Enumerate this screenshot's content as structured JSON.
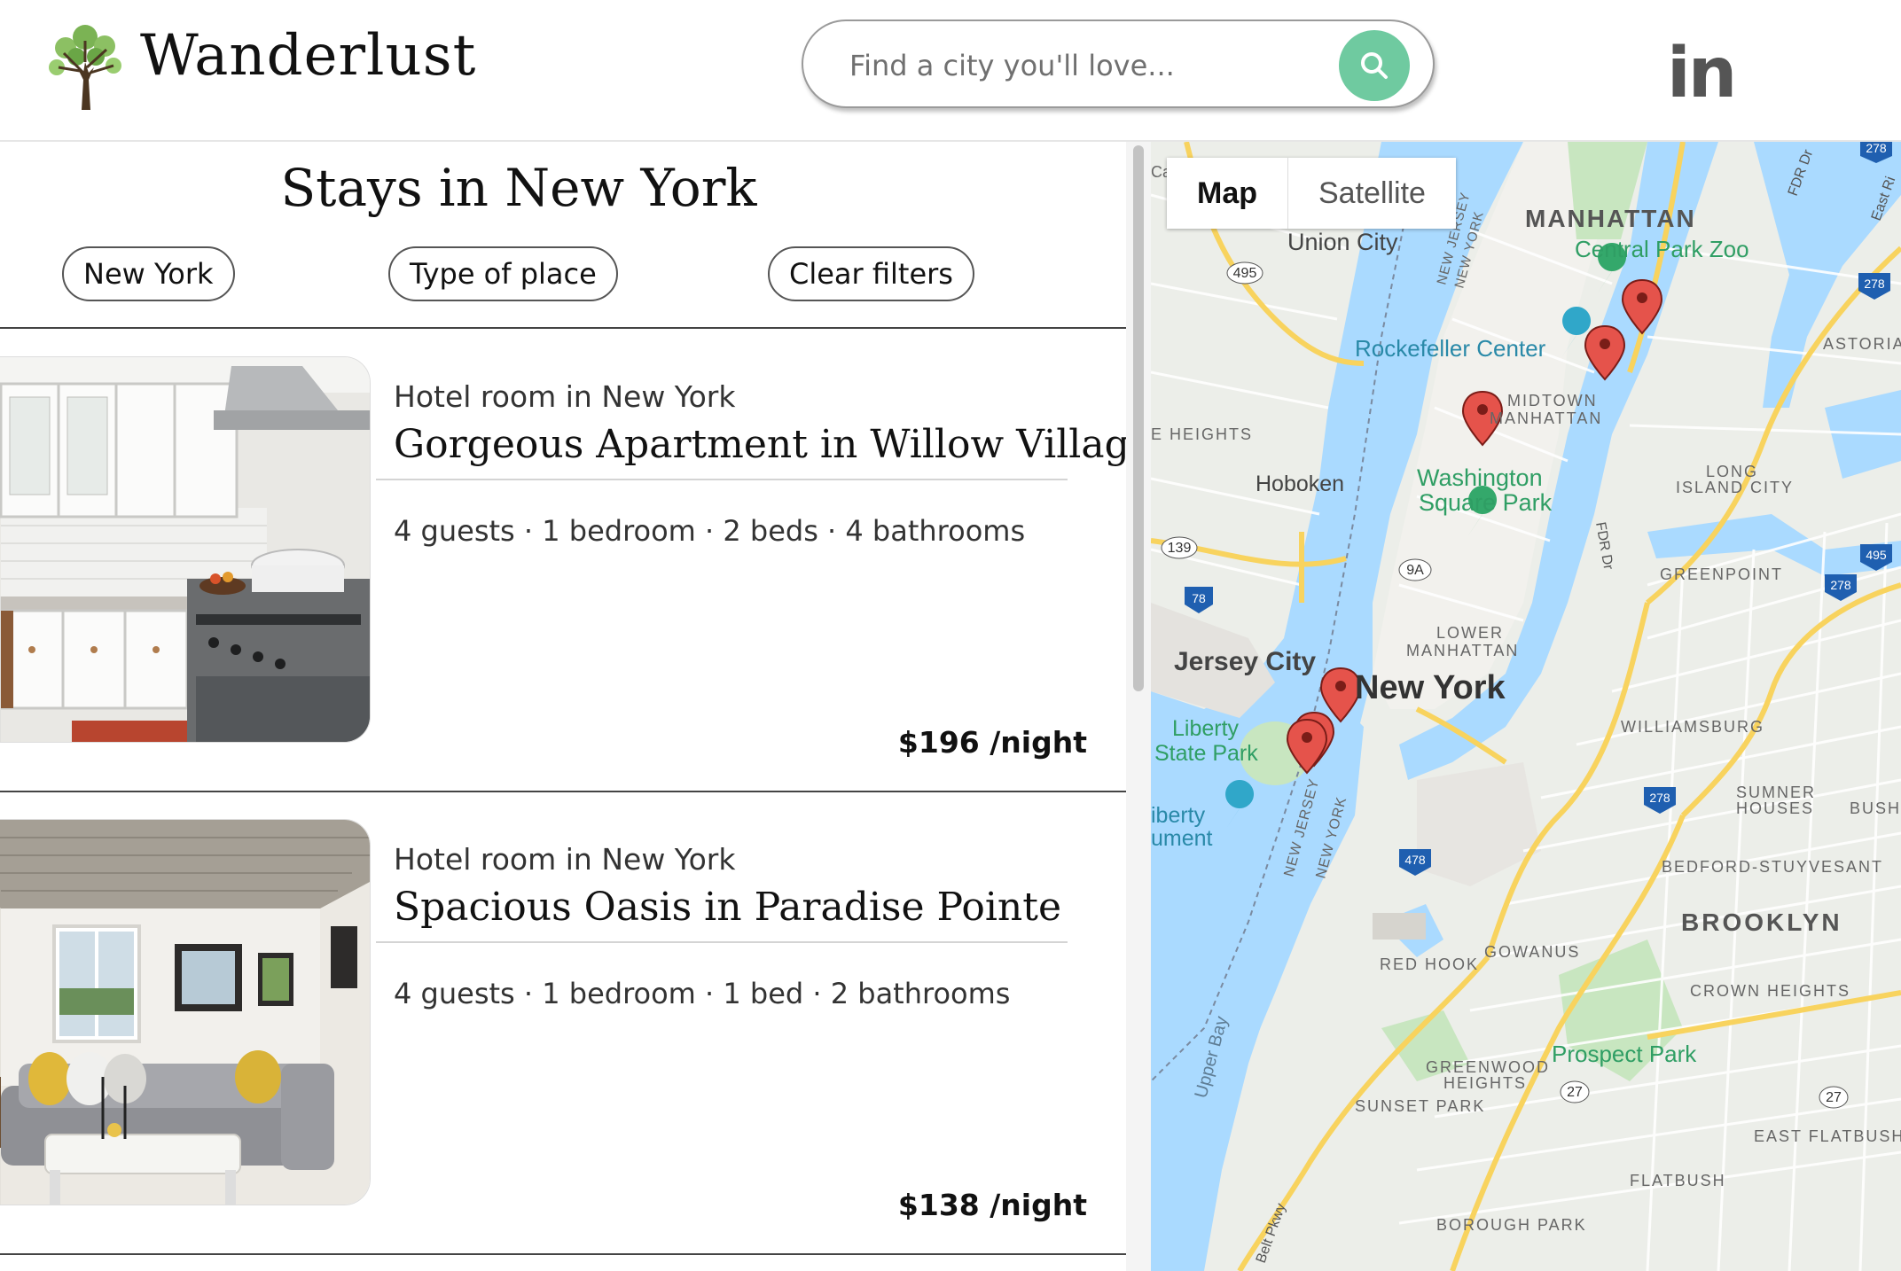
{
  "header": {
    "brand": "Wanderlust",
    "search_placeholder": "Find a city you'll love...",
    "linkedin": "in"
  },
  "main": {
    "title": "Stays in New York",
    "filters": [
      "New York",
      "Type of place",
      "Clear filters"
    ]
  },
  "listings": [
    {
      "type": "Hotel room in New York",
      "name": "Gorgeous Apartment in Willow Village",
      "details": "4 guests · 1 bedroom · 2 beds · 4 bathrooms",
      "price": "$196 /night"
    },
    {
      "type": "Hotel room in New York",
      "name": "Spacious Oasis in Paradise Pointe",
      "details": "4 guests · 1 bedroom · 1 bed · 2 bathrooms",
      "price": "$138 /night"
    }
  ],
  "map": {
    "types": [
      "Map",
      "Satellite"
    ],
    "labels": {
      "manhattan": "MANHATTAN",
      "central_park_zoo": "Central Park Zoo",
      "union_city": "Union City",
      "rockefeller": "Rockefeller Center",
      "astoria": "ASTORIA",
      "midtown": "MIDTOWN",
      "midtown2": "MANHATTAN",
      "heights": "E HEIGHTS",
      "hoboken": "Hoboken",
      "washington": "Washington",
      "washington2": "Square Park",
      "long_island": "LONG",
      "long_island2": "ISLAND CITY",
      "greenpoint": "GREENPOINT",
      "lower": "LOWER",
      "lower2": "MANHATTAN",
      "jersey_city": "Jersey City",
      "new_york": "New York",
      "liberty": "Liberty",
      "liberty2": "State Park",
      "liberty_mon": "iberty",
      "liberty_mon2": "ument",
      "williamsburg": "WILLIAMSBURG",
      "sumner": "SUMNER",
      "sumner2": "HOUSES",
      "bush": "BUSH",
      "bedford": "BEDFORD-STUYVESANT",
      "brooklyn": "BROOKLYN",
      "red_hook": "RED HOOK",
      "gowanus": "GOWANUS",
      "crown": "CROWN HEIGHTS",
      "prospect": "Prospect Park",
      "greenwood": "GREENWOOD",
      "greenwood2": "HEIGHTS",
      "sunset": "SUNSET PARK",
      "east_flatbush": "EAST FLATBUSH",
      "flatbush": "FLATBUSH",
      "borough_park": "BOROUGH PARK",
      "upper_bay": "Upper Bay",
      "belt": "Belt Pkwy",
      "fdr": "FDR Dr",
      "fdr2": "FDR Dr",
      "east_river": "East Ri",
      "nj1": "NEW JERSEY",
      "ny1": "NEW YORK",
      "nj2": "NEW JERSEY",
      "ny2": "NEW YORK",
      "partial_ca": "Ca"
    },
    "shields": [
      "495",
      "139",
      "9A",
      "78",
      "278",
      "278",
      "495",
      "278",
      "278",
      "478",
      "27",
      "27",
      "278"
    ]
  },
  "colors": {
    "accent": "#6fcaa0",
    "water": "#aadaff",
    "park": "#c8e6c0",
    "marker": "#e5534b",
    "highway": "#f8d35e"
  }
}
